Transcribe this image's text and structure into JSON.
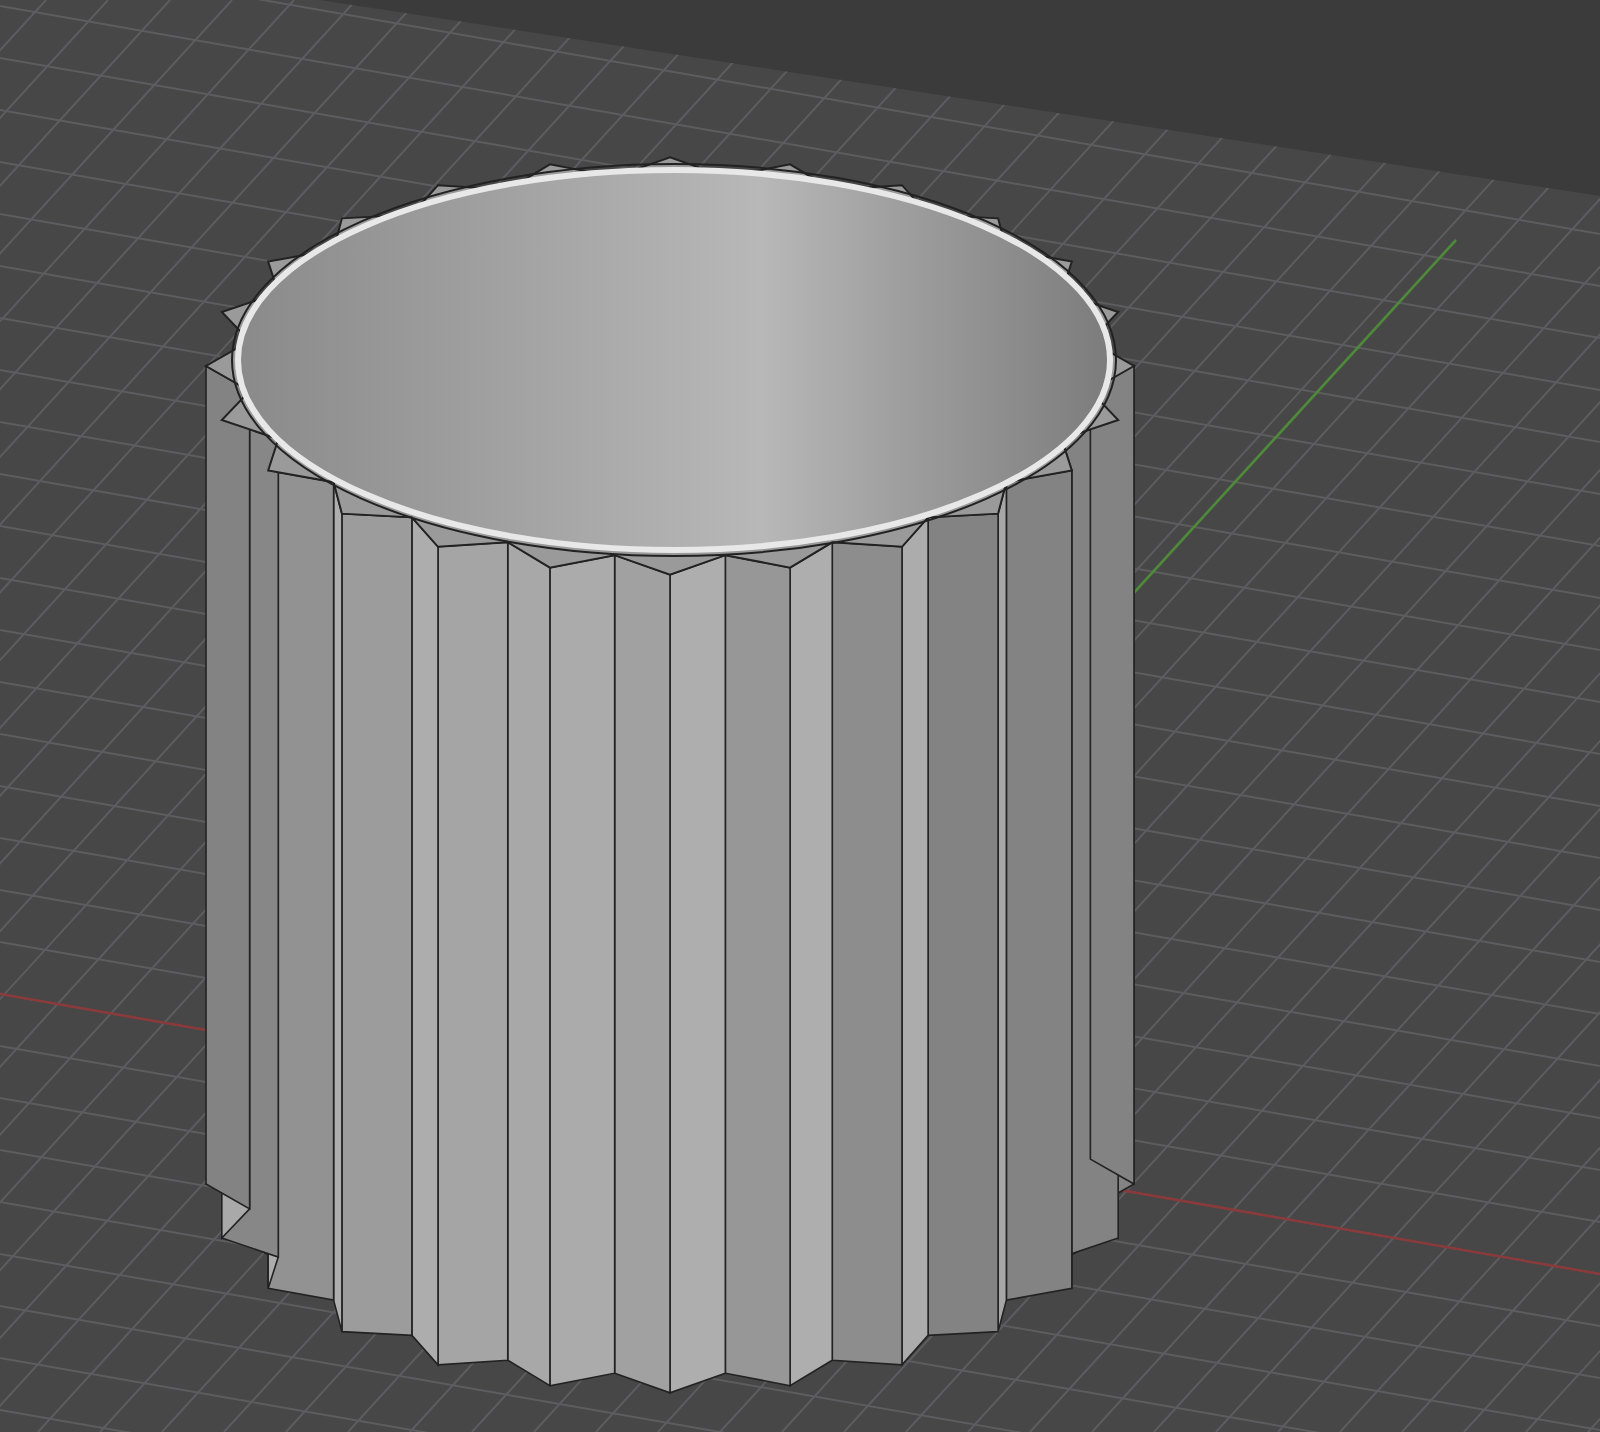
{
  "viewport": {
    "grid": true,
    "axes": true,
    "model": {
      "kind": "fluted-cylinder"
    }
  }
}
